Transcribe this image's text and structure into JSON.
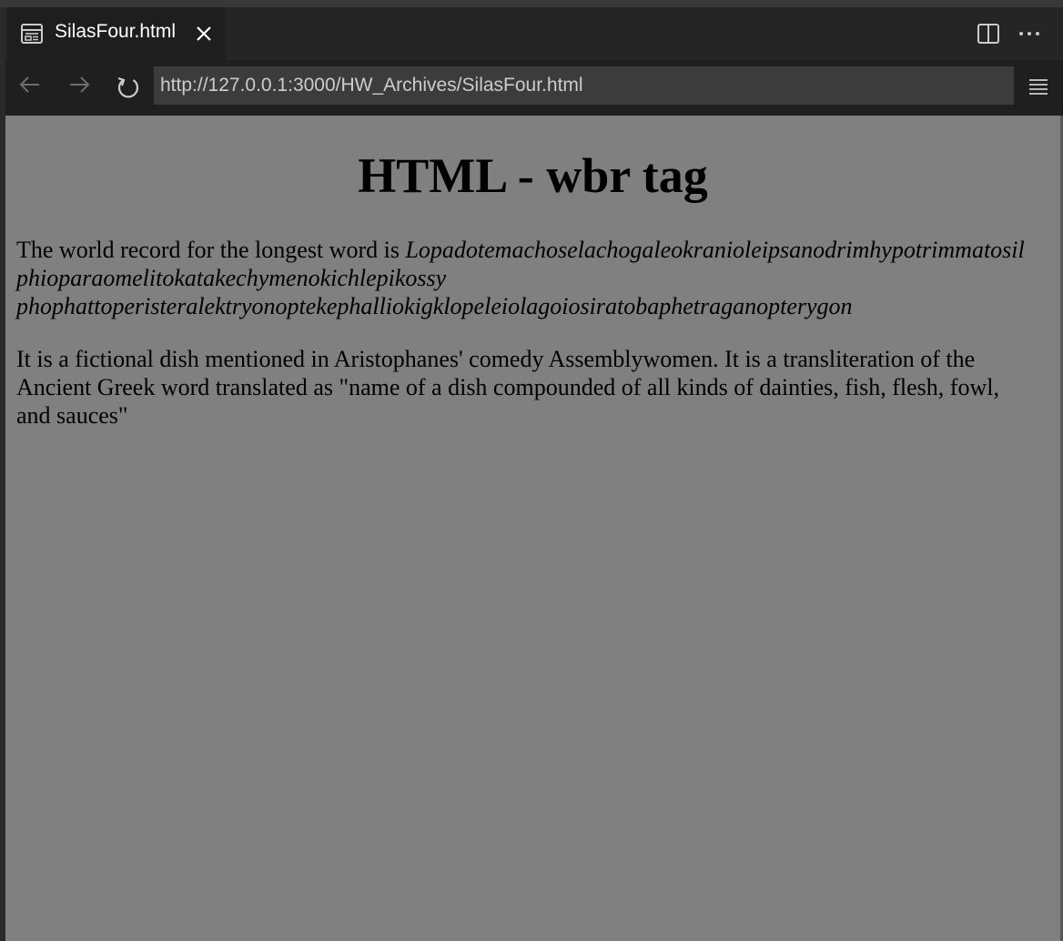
{
  "tab": {
    "title": "SilasFour.html",
    "icon": "preview-icon",
    "close_icon": "close-icon"
  },
  "editor_actions": {
    "split_icon": "split-editor-icon",
    "more_icon": "more-actions-icon"
  },
  "nav": {
    "back_icon": "arrow-left-icon",
    "forward_icon": "arrow-right-icon",
    "reload_icon": "reload-icon",
    "url": "http://127.0.0.1:3000/HW_Archives/SilasFour.html",
    "menu_icon": "menu-icon"
  },
  "page": {
    "heading": "HTML - wbr tag",
    "para1_text": "The world record for the longest word is ",
    "para1_word_line1": "Lopadotemachoselachogaleokranioleipsanodrimhypotrimmatosil",
    "para1_word_line2": "phioparaomelitokatakechymenokichlepikossy",
    "para1_word_line3": "phophattoperisteralektryonoptekephalliokigklopeleiolagoiosiratobaphetraganopterygon",
    "para2_line1": "It is a fictional dish mentioned in Aristophanes' comedy Assemblywomen. It is a transliteration of the",
    "para2_line2": "Ancient Greek word translated as \"name of a dish compounded of all kinds of dainties, fish, flesh, fowl,",
    "para2_line3": "and sauces\""
  },
  "colors": {
    "page_background": "#808080",
    "tabbar": "#252526",
    "active_tab": "#1e1e1e",
    "url_box": "#3c3c3c"
  }
}
